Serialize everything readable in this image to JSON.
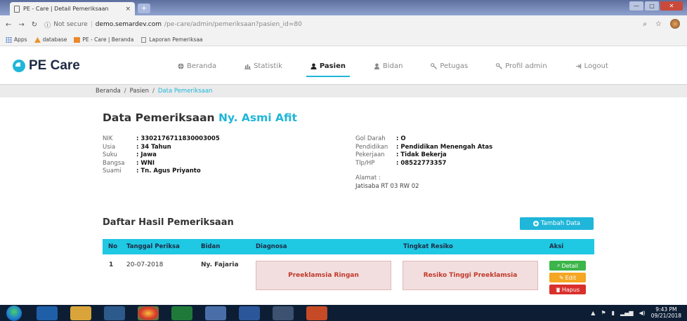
{
  "browser": {
    "tab_title": "PE - Care | Detail Pemeriksaan",
    "tab_close": "×",
    "new_tab": "+",
    "security": "Not secure",
    "host": "demo.semardev.com",
    "path": "/pe-care/admin/pemeriksaan?pasien_id=80",
    "bookmarks": [
      "Apps",
      "database",
      "PE - Care | Beranda",
      "Laporan Pemeriksaa"
    ]
  },
  "site": {
    "logo": "PE Care",
    "nav": [
      {
        "label": "Beranda",
        "icon": "globe-icon"
      },
      {
        "label": "Statistik",
        "icon": "bar-chart-icon"
      },
      {
        "label": "Pasien",
        "icon": "user-icon"
      },
      {
        "label": "Bidan",
        "icon": "nurse-icon"
      },
      {
        "label": "Petugas",
        "icon": "key-icon"
      },
      {
        "label": "Profil admin",
        "icon": "key-icon"
      },
      {
        "label": "Logout",
        "icon": "logout-icon"
      }
    ]
  },
  "breadcrumb": {
    "home": "Beranda",
    "parent": "Pasien",
    "current": "Data Pemeriksaan",
    "sep": "/"
  },
  "page": {
    "title": "Data Pemeriksaan",
    "patient_name": "Ny. Asmi Afit"
  },
  "patient_left": [
    {
      "k": "NIK",
      "v": ": 3302176711830003005"
    },
    {
      "k": "Usia",
      "v": ": 34 Tahun"
    },
    {
      "k": "Suku",
      "v": ": Jawa"
    },
    {
      "k": "Bangsa",
      "v": ": WNI"
    },
    {
      "k": "Suami",
      "v": ": Tn. Agus Priyanto"
    }
  ],
  "patient_right": [
    {
      "k": "Gol Darah",
      "v": ": O"
    },
    {
      "k": "Pendidikan",
      "v": ": Pendidikan Menengah Atas"
    },
    {
      "k": "Pekerjaan",
      "v": ": Tidak Bekerja"
    },
    {
      "k": "Tlp/HP",
      "v": ": 08522773357"
    }
  ],
  "address": {
    "label": "Alamat :",
    "value": "Jatisaba RT 03 RW 02"
  },
  "results": {
    "title": "Daftar Hasil Pemeriksaan",
    "add_button": "Tambah Data",
    "headers": [
      "No",
      "Tanggal Periksa",
      "Bidan",
      "Diagnosa",
      "Tingkat Resiko",
      "Aksi"
    ],
    "rows": [
      {
        "no": "1",
        "date": "20-07-2018",
        "bidan": "Ny. Fajaria",
        "diagnosa": "Preeklamsia Ringan",
        "resiko": "Resiko Tinggi Preeklamsia",
        "actions": [
          "Detail",
          "Edit",
          "Hapus"
        ]
      }
    ]
  },
  "taskbar": {
    "time": "9:43 PM",
    "date": "09/21/2018"
  },
  "colors": {
    "accent": "#1fb6d9",
    "table_header": "#1fc8e3",
    "danger_bg": "#f2dede",
    "danger_text": "#c0392b"
  }
}
